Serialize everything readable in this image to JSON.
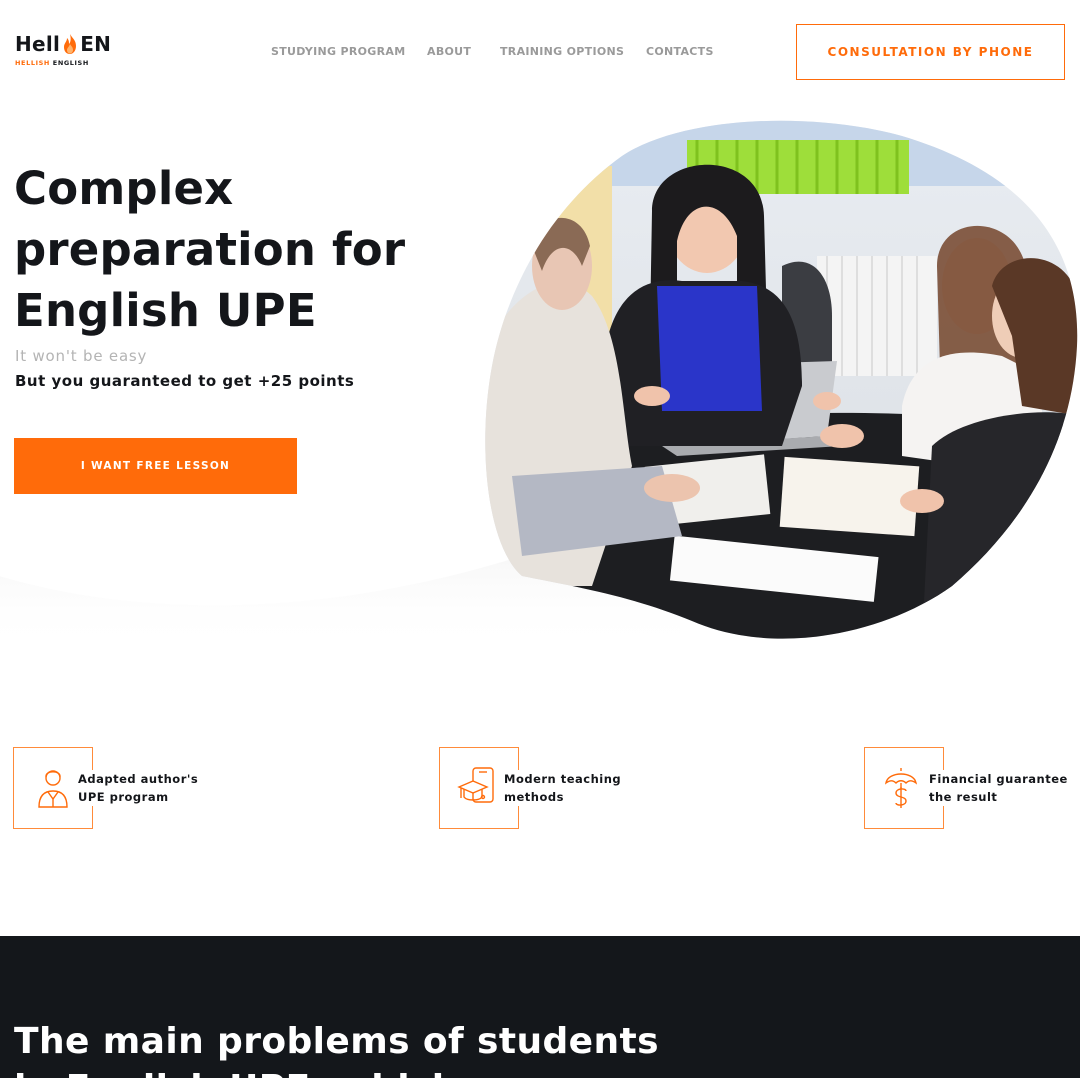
{
  "brand": {
    "logo_left": "Hell",
    "logo_right": "EN",
    "logo_sub_orange": "HELLISH",
    "logo_sub_dark": "ENGLISH",
    "accent_color": "#ff6b0a",
    "dark_color": "#14171b"
  },
  "nav": {
    "items": [
      {
        "label": "STUDYING PROGRAM"
      },
      {
        "label": "ABOUT"
      },
      {
        "label": "TRAINING OPTIONS"
      },
      {
        "label": "CONTACTS"
      }
    ],
    "consult_label": "CONSULTATION BY PHONE"
  },
  "hero": {
    "title_line1": "Complex",
    "title_line2": "preparation for",
    "title_line3": "English UPE",
    "subtitle": "It won't be easy",
    "guarantee": "But you guaranteed to get +25 points",
    "cta_label": "I WANT FREE LESSON",
    "photo_icon": "classroom-photo"
  },
  "features": [
    {
      "icon": "teacher-icon",
      "line1": "Adapted author's",
      "line2": "UPE program"
    },
    {
      "icon": "graduation-cap-phone-icon",
      "line1": "Modern teaching",
      "line2": "methods"
    },
    {
      "icon": "umbrella-dollar-icon",
      "line1": "Financial guarantee",
      "line2": "the result"
    }
  ],
  "problems": {
    "title_line1": "The main problems of students",
    "title_line2": "in English UPE, which"
  }
}
